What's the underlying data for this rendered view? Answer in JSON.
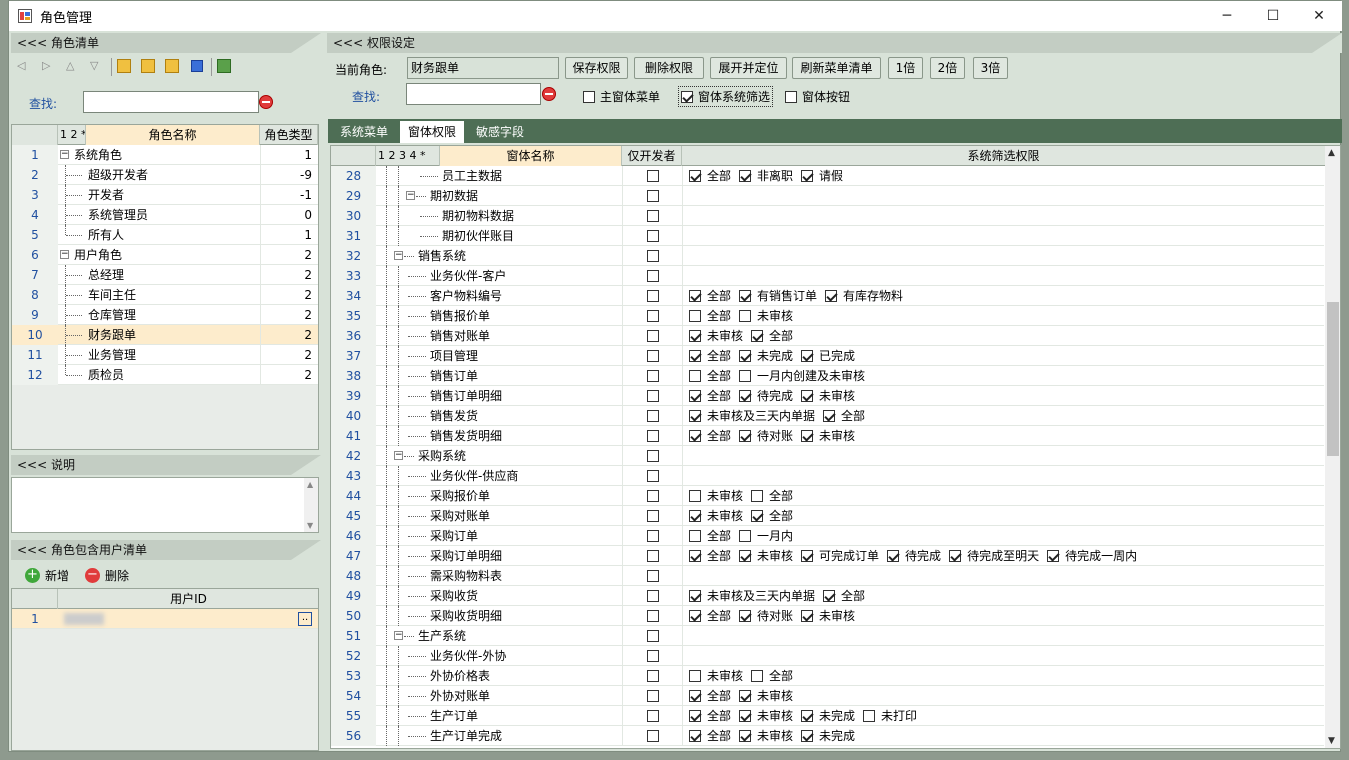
{
  "window": {
    "title": "角色管理",
    "minimize": "─",
    "maximize": "☐",
    "close": "✕"
  },
  "left": {
    "roles_header": "<<< 角色清单",
    "search_label": "查找:",
    "search_value": "",
    "grid_headers": {
      "nums": "1 2 *",
      "name": "角色名称",
      "type": "角色类型"
    },
    "roles": [
      {
        "no": "1",
        "name": "系统角色",
        "type": "1",
        "level": 0,
        "group": true
      },
      {
        "no": "2",
        "name": "超级开发者",
        "type": "-9",
        "level": 1
      },
      {
        "no": "3",
        "name": "开发者",
        "type": "-1",
        "level": 1
      },
      {
        "no": "4",
        "name": "系统管理员",
        "type": "0",
        "level": 1
      },
      {
        "no": "5",
        "name": "所有人",
        "type": "1",
        "level": 1
      },
      {
        "no": "6",
        "name": "用户角色",
        "type": "2",
        "level": 0,
        "group": true
      },
      {
        "no": "7",
        "name": "总经理",
        "type": "2",
        "level": 1
      },
      {
        "no": "8",
        "name": "车间主任",
        "type": "2",
        "level": 1
      },
      {
        "no": "9",
        "name": "仓库管理",
        "type": "2",
        "level": 1
      },
      {
        "no": "10",
        "name": "财务跟单",
        "type": "2",
        "level": 1,
        "selected": true
      },
      {
        "no": "11",
        "name": "业务管理",
        "type": "2",
        "level": 1
      },
      {
        "no": "12",
        "name": "质检员",
        "type": "2",
        "level": 1
      }
    ],
    "desc_header": "<<< 说明",
    "users_header": "<<< 角色包含用户清单",
    "add_label": "新增",
    "del_label": "删除",
    "user_col": "用户ID",
    "users": [
      {
        "no": "1",
        "id": "",
        "btn": ".."
      }
    ]
  },
  "right": {
    "header": "<<< 权限设定",
    "current_role_label": "当前角色:",
    "current_role_value": "财务跟单",
    "buttons": [
      "保存权限",
      "删除权限",
      "展开并定位",
      "刷新菜单清单",
      "1倍",
      "2倍",
      "3倍"
    ],
    "search_label": "查找:",
    "search_value": "",
    "opt_main": {
      "label": "主窗体菜单",
      "checked": false
    },
    "opt_filter": {
      "label": "窗体系统筛选",
      "checked": true
    },
    "opt_button": {
      "label": "窗体按钮",
      "checked": false
    },
    "tabs": [
      "系统菜单",
      "窗体权限",
      "敏感字段"
    ],
    "active_tab": 1,
    "grid_headers": {
      "nums": "1 2 3 4 *",
      "name": "窗体名称",
      "dev": "仅开发者",
      "filter": "系统筛选权限"
    },
    "rows": [
      {
        "no": "28",
        "name": "员工主数据",
        "level": 2,
        "filters": [
          [
            "全部",
            1
          ],
          [
            "非离职",
            1
          ],
          [
            "请假",
            1
          ]
        ]
      },
      {
        "no": "29",
        "name": "期初数据",
        "level": 1,
        "group": true,
        "filters": []
      },
      {
        "no": "30",
        "name": "期初物料数据",
        "level": 2,
        "filters": []
      },
      {
        "no": "31",
        "name": "期初伙伴账目",
        "level": 2,
        "filters": []
      },
      {
        "no": "32",
        "name": "销售系统",
        "level": 0,
        "group": true,
        "filters": []
      },
      {
        "no": "33",
        "name": "业务伙伴-客户",
        "level": 1,
        "filters": []
      },
      {
        "no": "34",
        "name": "客户物料编号",
        "level": 1,
        "filters": [
          [
            "全部",
            1
          ],
          [
            "有销售订单",
            1
          ],
          [
            "有库存物料",
            1
          ]
        ]
      },
      {
        "no": "35",
        "name": "销售报价单",
        "level": 1,
        "filters": [
          [
            "全部",
            0
          ],
          [
            "未审核",
            0
          ]
        ]
      },
      {
        "no": "36",
        "name": "销售对账单",
        "level": 1,
        "filters": [
          [
            "未审核",
            1
          ],
          [
            "全部",
            1
          ]
        ]
      },
      {
        "no": "37",
        "name": "项目管理",
        "level": 1,
        "filters": [
          [
            "全部",
            1
          ],
          [
            "未完成",
            1
          ],
          [
            "已完成",
            1
          ]
        ]
      },
      {
        "no": "38",
        "name": "销售订单",
        "level": 1,
        "filters": [
          [
            "全部",
            0
          ],
          [
            "一月内创建及未审核",
            0
          ]
        ]
      },
      {
        "no": "39",
        "name": "销售订单明细",
        "level": 1,
        "filters": [
          [
            "全部",
            1
          ],
          [
            "待完成",
            1
          ],
          [
            "未审核",
            1
          ]
        ]
      },
      {
        "no": "40",
        "name": "销售发货",
        "level": 1,
        "filters": [
          [
            "未审核及三天内单据",
            1
          ],
          [
            "全部",
            1
          ]
        ]
      },
      {
        "no": "41",
        "name": "销售发货明细",
        "level": 1,
        "filters": [
          [
            "全部",
            1
          ],
          [
            "待对账",
            1
          ],
          [
            "未审核",
            1
          ]
        ]
      },
      {
        "no": "42",
        "name": "采购系统",
        "level": 0,
        "group": true,
        "filters": []
      },
      {
        "no": "43",
        "name": "业务伙伴-供应商",
        "level": 1,
        "filters": []
      },
      {
        "no": "44",
        "name": "采购报价单",
        "level": 1,
        "filters": [
          [
            "未审核",
            0
          ],
          [
            "全部",
            0
          ]
        ]
      },
      {
        "no": "45",
        "name": "采购对账单",
        "level": 1,
        "filters": [
          [
            "未审核",
            1
          ],
          [
            "全部",
            1
          ]
        ]
      },
      {
        "no": "46",
        "name": "采购订单",
        "level": 1,
        "filters": [
          [
            "全部",
            0
          ],
          [
            "一月内",
            0
          ]
        ]
      },
      {
        "no": "47",
        "name": "采购订单明细",
        "level": 1,
        "filters": [
          [
            "全部",
            1
          ],
          [
            "未审核",
            1
          ],
          [
            "可完成订单",
            1
          ],
          [
            "待完成",
            1
          ],
          [
            "待完成至明天",
            1
          ],
          [
            "待完成一周内",
            1
          ]
        ]
      },
      {
        "no": "48",
        "name": "需采购物料表",
        "level": 1,
        "filters": []
      },
      {
        "no": "49",
        "name": "采购收货",
        "level": 1,
        "filters": [
          [
            "未审核及三天内单据",
            1
          ],
          [
            "全部",
            1
          ]
        ]
      },
      {
        "no": "50",
        "name": "采购收货明细",
        "level": 1,
        "filters": [
          [
            "全部",
            1
          ],
          [
            "待对账",
            1
          ],
          [
            "未审核",
            1
          ]
        ]
      },
      {
        "no": "51",
        "name": "生产系统",
        "level": 0,
        "group": true,
        "filters": []
      },
      {
        "no": "52",
        "name": "业务伙伴-外协",
        "level": 1,
        "filters": []
      },
      {
        "no": "53",
        "name": "外协价格表",
        "level": 1,
        "filters": [
          [
            "未审核",
            0
          ],
          [
            "全部",
            0
          ]
        ]
      },
      {
        "no": "54",
        "name": "外协对账单",
        "level": 1,
        "filters": [
          [
            "全部",
            1
          ],
          [
            "未审核",
            1
          ]
        ]
      },
      {
        "no": "55",
        "name": "生产订单",
        "level": 1,
        "filters": [
          [
            "全部",
            1
          ],
          [
            "未审核",
            1
          ],
          [
            "未完成",
            1
          ],
          [
            "未打印",
            0
          ]
        ]
      },
      {
        "no": "56",
        "name": "生产订单完成",
        "level": 1,
        "filters": [
          [
            "全部",
            1
          ],
          [
            "未审核",
            1
          ],
          [
            "未完成",
            1
          ]
        ]
      }
    ]
  },
  "colors": {
    "selected_row": "#fdeccc",
    "tab_bar": "#4e6e55",
    "panel_bg": "#d8e2d8"
  }
}
